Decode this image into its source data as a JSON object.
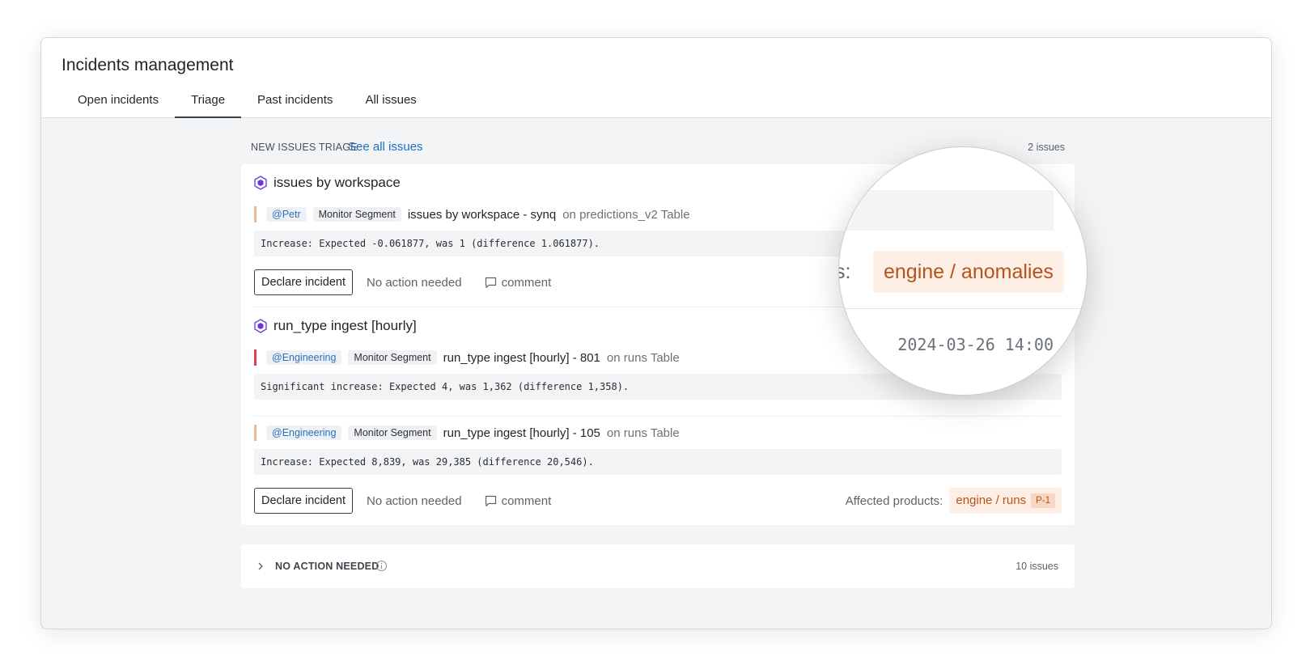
{
  "window": {
    "title": "Incidents management",
    "tabs": [
      {
        "label": "Open incidents"
      },
      {
        "label": "Triage"
      },
      {
        "label": "Past incidents"
      },
      {
        "label": "All issues"
      }
    ],
    "active_tab": "Triage"
  },
  "triage": {
    "section_label": "NEW ISSUES TRIAGE",
    "see_all_label": "See all issues",
    "count_label": "2 issues",
    "groups": [
      {
        "title": "issues by workspace",
        "issues": [
          {
            "owner": "@Petr",
            "segment": "Monitor Segment",
            "name": "issues by workspace - synq",
            "on": "on predictions_v2 Table",
            "message": "Increase: Expected -0.061877, was 1 (difference 1.061877)."
          }
        ],
        "actions": {
          "declare": "Declare incident",
          "no_action": "No action needed",
          "comment": "comment"
        }
      },
      {
        "title": "run_type ingest [hourly]",
        "issues": [
          {
            "owner": "@Engineering",
            "segment": "Monitor Segment",
            "name": "run_type ingest [hourly] - 801",
            "on": "on runs Table",
            "message": "Significant increase: Expected 4, was 1,362 (difference 1,358)."
          },
          {
            "owner": "@Engineering",
            "segment": "Monitor Segment",
            "name": "run_type ingest [hourly] - 105",
            "on": "on runs Table",
            "message": "Increase: Expected 8,839, was 29,385 (difference 20,546)."
          }
        ],
        "actions": {
          "declare": "Declare incident",
          "no_action": "No action needed",
          "comment": "comment"
        },
        "affected_label": "Affected products:",
        "product": "engine / runs",
        "priority": "P-1"
      }
    ]
  },
  "no_action_section": {
    "label": "NO ACTION NEEDED",
    "count_label": "10 issues"
  },
  "magnifier": {
    "label_fragment": "ts:",
    "product": "engine / anomalies",
    "timestamp": "2024-03-26 14:00",
    "peek_timestamp_fragment": "00"
  },
  "colors": {
    "accent_link": "#1e6fc2",
    "product_chip_bg": "#fdeee6",
    "product_chip_text": "#b5531b",
    "severity_orange": "#f2b98f",
    "severity_red": "#e03f4f",
    "group_icon": "#6a35d9"
  }
}
